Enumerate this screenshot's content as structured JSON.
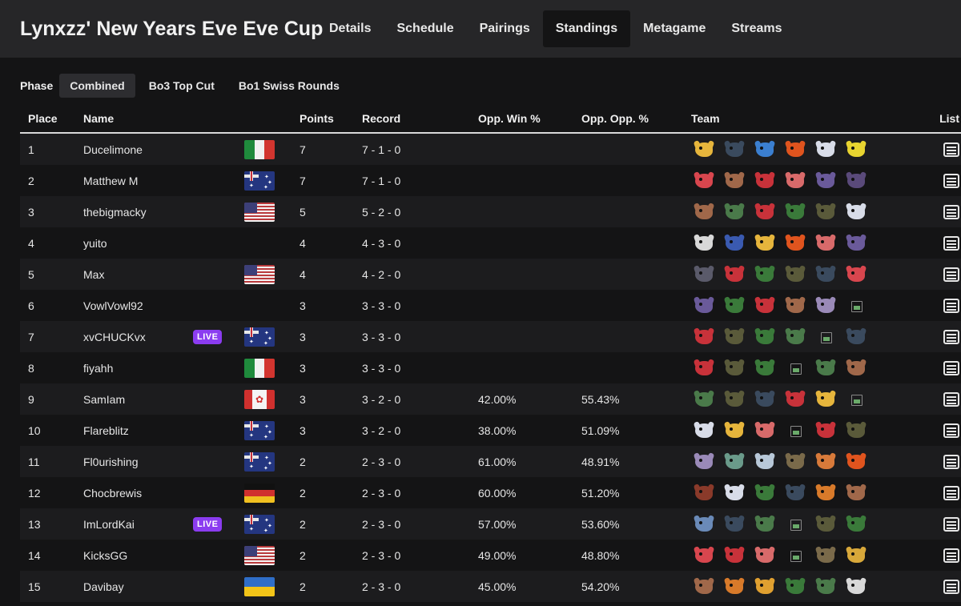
{
  "header": {
    "title": "Lynxzz' New Years Eve Eve Cup",
    "nav": [
      {
        "label": "Details"
      },
      {
        "label": "Schedule"
      },
      {
        "label": "Pairings"
      },
      {
        "label": "Standings",
        "active": true
      },
      {
        "label": "Metagame"
      },
      {
        "label": "Streams"
      }
    ]
  },
  "phase": {
    "label": "Phase",
    "options": [
      {
        "label": "Combined",
        "active": true
      },
      {
        "label": "Bo3 Top Cut"
      },
      {
        "label": "Bo1 Swiss Rounds"
      }
    ]
  },
  "columns": {
    "place": "Place",
    "name": "Name",
    "points": "Points",
    "record": "Record",
    "opp_win": "Opp. Win %",
    "opp_opp": "Opp. Opp. %",
    "team": "Team",
    "list": "List"
  },
  "live_label": "LIVE",
  "colors": {
    "live": "#8b3cf0",
    "background": "#141415",
    "topbar": "#262628"
  },
  "rows": [
    {
      "place": "1",
      "name": "Ducelimone",
      "flag": "it",
      "live": false,
      "points": "7",
      "record": "7 - 1 - 0",
      "opp_win": "",
      "opp_opp": "",
      "team": [
        "#e6b53c",
        "#3a4a5e",
        "#3b7fd0",
        "#e0541e",
        "#d8dce8",
        "#e8d430"
      ]
    },
    {
      "place": "2",
      "name": "Matthew M",
      "flag": "au",
      "live": false,
      "points": "7",
      "record": "7 - 1 - 0",
      "opp_win": "",
      "opp_opp": "",
      "team": [
        "#d8464e",
        "#a0684a",
        "#c8323a",
        "#d86a6a",
        "#6a5a9a",
        "#5a4a7a"
      ]
    },
    {
      "place": "3",
      "name": "thebigmacky",
      "flag": "us",
      "live": false,
      "points": "5",
      "record": "5 - 2 - 0",
      "opp_win": "",
      "opp_opp": "",
      "team": [
        "#a0684a",
        "#4a7a4a",
        "#c8323a",
        "#3a7a3a",
        "#5a5a3a",
        "#d8dce8"
      ]
    },
    {
      "place": "4",
      "name": "yuito",
      "flag": "",
      "live": false,
      "points": "4",
      "record": "4 - 3 - 0",
      "opp_win": "",
      "opp_opp": "",
      "team": [
        "#d8d8d8",
        "#3a5ab0",
        "#e6b53c",
        "#e0541e",
        "#d86a6a",
        "#6a5a9a"
      ]
    },
    {
      "place": "5",
      "name": "Max",
      "flag": "us",
      "live": false,
      "points": "4",
      "record": "4 - 2 - 0",
      "opp_win": "",
      "opp_opp": "",
      "team": [
        "#5a5a6a",
        "#c8323a",
        "#3a7a3a",
        "#5a5a3a",
        "#3a4a5e",
        "#d8464e"
      ]
    },
    {
      "place": "6",
      "name": "VowlVowl92",
      "flag": "",
      "live": false,
      "points": "3",
      "record": "3 - 3 - 0",
      "opp_win": "",
      "opp_opp": "",
      "team": [
        "#6a5a9a",
        "#3a7a3a",
        "#c8323a",
        "#a0684a",
        "#9a8ab8",
        "broken"
      ]
    },
    {
      "place": "7",
      "name": "xvCHUCKvx",
      "flag": "au",
      "live": true,
      "points": "3",
      "record": "3 - 3 - 0",
      "opp_win": "",
      "opp_opp": "",
      "team": [
        "#c8323a",
        "#5a5a3a",
        "#3a7a3a",
        "#4a7a4a",
        "broken",
        "#3a4a5e"
      ]
    },
    {
      "place": "8",
      "name": "fiyahh",
      "flag": "it",
      "live": false,
      "points": "3",
      "record": "3 - 3 - 0",
      "opp_win": "",
      "opp_opp": "",
      "team": [
        "#c8323a",
        "#5a5a3a",
        "#3a7a3a",
        "broken",
        "#4a7a4a",
        "#a0684a"
      ]
    },
    {
      "place": "9",
      "name": "SamIam",
      "flag": "ca",
      "live": false,
      "points": "3",
      "record": "3 - 2 - 0",
      "opp_win": "42.00%",
      "opp_opp": "55.43%",
      "team": [
        "#4a7a4a",
        "#5a5a3a",
        "#3a4a5e",
        "#c8323a",
        "#e6b53c",
        "broken"
      ]
    },
    {
      "place": "10",
      "name": "Flareblitz",
      "flag": "au",
      "live": false,
      "points": "3",
      "record": "3 - 2 - 0",
      "opp_win": "38.00%",
      "opp_opp": "51.09%",
      "team": [
        "#d8dce8",
        "#e6b53c",
        "#d86a6a",
        "broken",
        "#c8323a",
        "#5a5a3a"
      ]
    },
    {
      "place": "11",
      "name": "Fl0urishing",
      "flag": "au",
      "live": false,
      "points": "2",
      "record": "2 - 3 - 0",
      "opp_win": "61.00%",
      "opp_opp": "48.91%",
      "team": [
        "#9a8ab8",
        "#6a9a8a",
        "#b8c8d8",
        "#7a6a4a",
        "#d87a3a",
        "#e0541e"
      ]
    },
    {
      "place": "12",
      "name": "Chocbrewis",
      "flag": "de",
      "live": false,
      "points": "2",
      "record": "2 - 3 - 0",
      "opp_win": "60.00%",
      "opp_opp": "51.20%",
      "team": [
        "#8a3a2a",
        "#d8dce8",
        "#3a7a3a",
        "#3a4a5e",
        "#d87a2a",
        "#a0684a"
      ]
    },
    {
      "place": "13",
      "name": "ImLordKai",
      "flag": "au",
      "live": true,
      "points": "2",
      "record": "2 - 3 - 0",
      "opp_win": "57.00%",
      "opp_opp": "53.60%",
      "team": [
        "#6a8ab8",
        "#3a4a5e",
        "#4a7a4a",
        "broken",
        "#5a5a3a",
        "#3a7a3a"
      ]
    },
    {
      "place": "14",
      "name": "KicksGG",
      "flag": "us",
      "live": false,
      "points": "2",
      "record": "2 - 3 - 0",
      "opp_win": "49.00%",
      "opp_opp": "48.80%",
      "team": [
        "#d8464e",
        "#c8323a",
        "#d86a6a",
        "broken",
        "#7a6a4a",
        "#d8a83a"
      ]
    },
    {
      "place": "15",
      "name": "Davibay",
      "flag": "ua",
      "live": false,
      "points": "2",
      "record": "2 - 3 - 0",
      "opp_win": "45.00%",
      "opp_opp": "54.20%",
      "team": [
        "#a0684a",
        "#d87a2a",
        "#e0a030",
        "#3a7a3a",
        "#4a7a4a",
        "#d8d8d8"
      ]
    }
  ]
}
